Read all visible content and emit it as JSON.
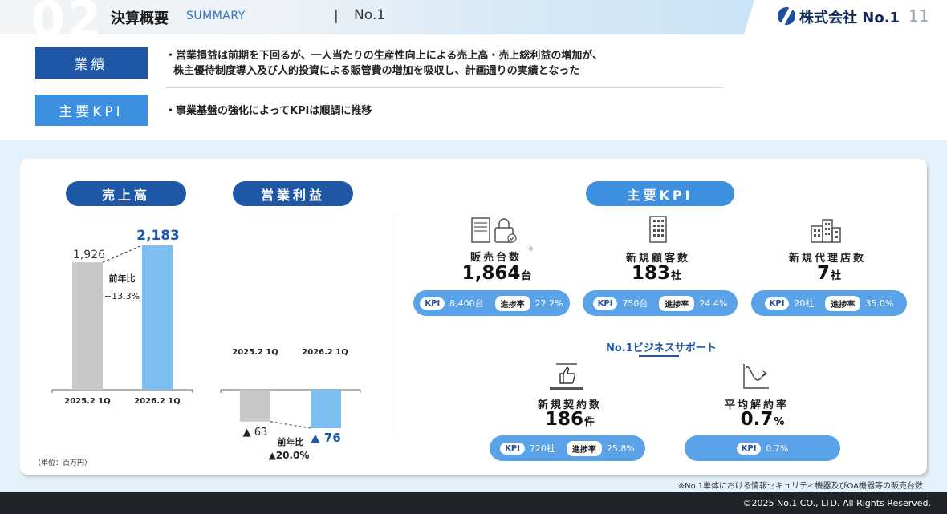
{
  "header": {
    "section_number": "02",
    "title": "決算概要",
    "subtitle": "SUMMARY",
    "separator": "|",
    "company_name": "No.1",
    "logo_text": "株式会社 No.1",
    "page_number": "11"
  },
  "summary": {
    "results_tag": "業績",
    "results_text_line1": "・営業損益は前期を下回るが、一人当たりの生産性向上による売上高・売上総利益の増加が、",
    "results_text_line2": "株主優待制度導入及び人的投資による販管費の増加を吸収し、計画通りの実績となった",
    "kpi_tag": "主要KPI",
    "kpi_text": "・事業基盤の強化によってKPIは順調に推移"
  },
  "sales": {
    "title": "売上高",
    "prev_value": "1,926",
    "curr_value": "2,183",
    "yoy_label": "前年比",
    "yoy_value": "+13.3%",
    "prev_label": "2025.2 1Q",
    "curr_label": "2026.2 1Q"
  },
  "operating_income": {
    "title": "営業利益",
    "prev_label": "2025.2 1Q",
    "curr_label": "2026.2 1Q",
    "prev_value": "▲ 63",
    "curr_value": "▲ 76",
    "yoy_label": "前年比",
    "yoy_value": "▲20.0%"
  },
  "unit_note": "（単位：百万円）",
  "kpi": {
    "title": "主要KPI",
    "sales_units": {
      "label": "販売台数",
      "note_mark": "※",
      "value": "1,864",
      "unit": "台",
      "kpi_badge": "KPI",
      "target": "8,400台",
      "progress_badge": "進捗率",
      "progress": "22.2%"
    },
    "new_customers": {
      "label": "新規顧客数",
      "value": "183",
      "unit": "社",
      "kpi_badge": "KPI",
      "target": "750台",
      "progress_badge": "進捗率",
      "progress": "24.4%"
    },
    "new_agencies": {
      "label": "新規代理店数",
      "value": "7",
      "unit": "社",
      "kpi_badge": "KPI",
      "target": "20社",
      "progress_badge": "進捗率",
      "progress": "35.0%"
    },
    "business_support_title": "No.1ビジネスサポート",
    "new_contracts": {
      "label": "新規契約数",
      "value": "186",
      "unit": "件",
      "kpi_badge": "KPI",
      "target": "720社",
      "progress_badge": "進捗率",
      "progress": "25.8%"
    },
    "avg_cancel_rate": {
      "label": "平均解約率",
      "value": "0.7",
      "unit": "%",
      "kpi_badge": "KPI",
      "target": "0.7%"
    }
  },
  "footnote": "※No.1単体における情報セキュリティ機器及びOA機器等の販売台数",
  "copyright": "©2025 No.1 CO., LTD. All Rights Reserved.",
  "chart_data": [
    {
      "type": "bar",
      "title": "売上高",
      "categories": [
        "2025.2 1Q",
        "2026.2 1Q"
      ],
      "values": [
        1926,
        2183
      ],
      "colors": [
        "#c8c8c8",
        "#7dbff0"
      ],
      "annotation": "前年比 +13.3%"
    },
    {
      "type": "bar",
      "title": "営業利益",
      "categories": [
        "2025.2 1Q",
        "2026.2 1Q"
      ],
      "values": [
        -63,
        -76
      ],
      "colors": [
        "#c8c8c8",
        "#7dbff0"
      ],
      "annotation": "前年比 ▲20.0%"
    }
  ],
  "colors": {
    "dark_blue": "#1d57a6",
    "light_blue": "#3d8fe0",
    "kpi_bar": "#5aa3e8",
    "panel_bg": "#e4f1fa",
    "footer": "#202328"
  }
}
